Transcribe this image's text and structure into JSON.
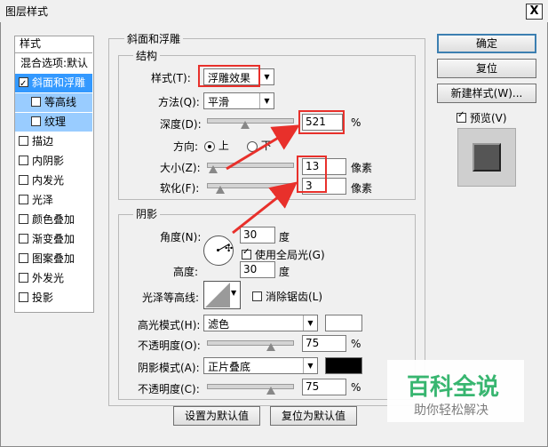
{
  "window": {
    "title": "图层样式",
    "close_label": "X"
  },
  "style_list": {
    "header": "样式",
    "items": [
      {
        "label": "混合选项:默认",
        "checkbox": false,
        "checked": false,
        "selected": false
      },
      {
        "label": "斜面和浮雕",
        "checkbox": true,
        "checked": true,
        "selected": true
      },
      {
        "label": "等高线",
        "checkbox": true,
        "checked": false,
        "selected": false,
        "sub": true
      },
      {
        "label": "纹理",
        "checkbox": true,
        "checked": false,
        "selected": false,
        "sub": true
      },
      {
        "label": "描边",
        "checkbox": true,
        "checked": false
      },
      {
        "label": "内阴影",
        "checkbox": true,
        "checked": false
      },
      {
        "label": "内发光",
        "checkbox": true,
        "checked": false
      },
      {
        "label": "光泽",
        "checkbox": true,
        "checked": false
      },
      {
        "label": "颜色叠加",
        "checkbox": true,
        "checked": false
      },
      {
        "label": "渐变叠加",
        "checkbox": true,
        "checked": false
      },
      {
        "label": "图案叠加",
        "checkbox": true,
        "checked": false
      },
      {
        "label": "外发光",
        "checkbox": true,
        "checked": false
      },
      {
        "label": "投影",
        "checkbox": true,
        "checked": false
      }
    ]
  },
  "bevel": {
    "section_title": "斜面和浮雕",
    "structure_title": "结构",
    "style_label": "样式(T):",
    "style_value": "浮雕效果",
    "technique_label": "方法(Q):",
    "technique_value": "平滑",
    "depth_label": "深度(D):",
    "depth_value": "521",
    "depth_unit": "%",
    "depth_level": 0.45,
    "direction_label": "方向:",
    "direction_up": "上",
    "direction_down": "下",
    "direction_selected": "上",
    "size_label": "大小(Z):",
    "size_value": "13",
    "size_unit": "像素",
    "size_level": 0.07,
    "soften_label": "软化(F):",
    "soften_value": "3",
    "soften_unit": "像素",
    "soften_level": 0.16
  },
  "shading": {
    "title": "阴影",
    "angle_label": "角度(N):",
    "angle_value": "30",
    "angle_unit": "度",
    "global_light_label": "使用全局光(G)",
    "global_light_checked": true,
    "altitude_label": "高度:",
    "altitude_value": "30",
    "altitude_unit": "度",
    "gloss_label": "光泽等高线:",
    "antialias_label": "消除锯齿(L)",
    "antialias_checked": false,
    "highlight_mode_label": "高光模式(H):",
    "highlight_mode_value": "滤色",
    "highlight_color": "#ffffff",
    "highlight_opacity_label": "不透明度(O):",
    "highlight_opacity_value": "75",
    "highlight_opacity_level": 0.75,
    "shadow_mode_label": "阴影模式(A):",
    "shadow_mode_value": "正片叠底",
    "shadow_color": "#000000",
    "shadow_opacity_label": "不透明度(C):",
    "shadow_opacity_value": "75",
    "shadow_opacity_level": 0.75,
    "percent": "%"
  },
  "footer": {
    "make_default": "设置为默认值",
    "reset_default": "复位为默认值"
  },
  "right": {
    "ok": "确定",
    "reset": "复位",
    "new_style": "新建样式(W)...",
    "preview_label": "预览(V)",
    "preview_checked": true
  },
  "watermark": {
    "title": "百科全说",
    "subtitle": "助你轻松解决",
    "title_color": "#2fb36a"
  },
  "annotation_color": "#e8302b"
}
